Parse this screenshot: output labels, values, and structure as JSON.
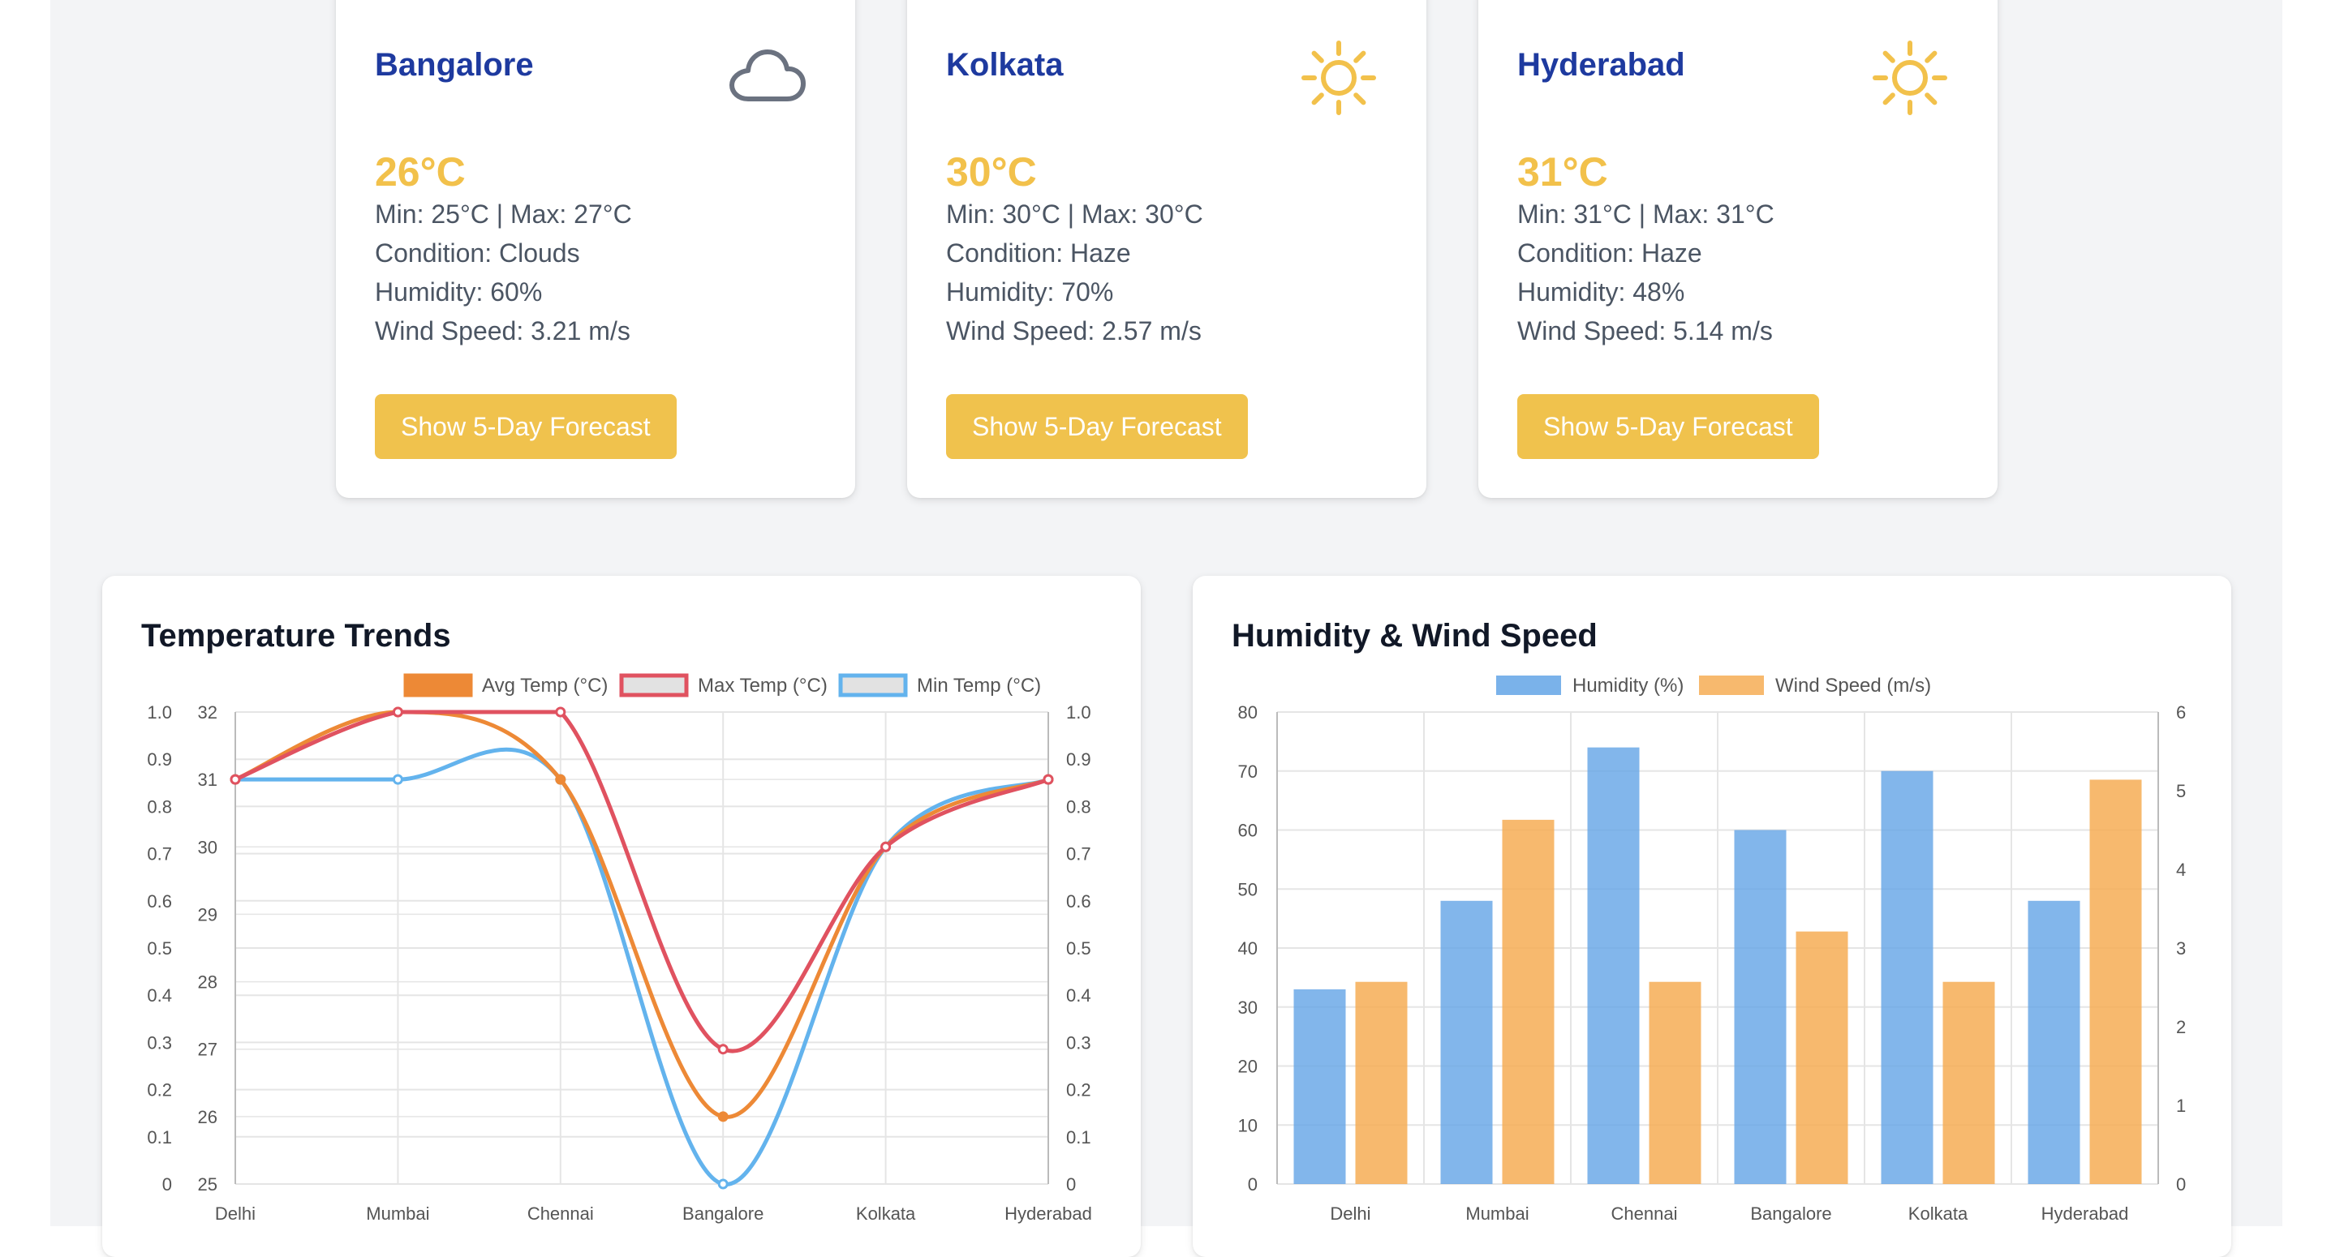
{
  "cities": [
    {
      "name": "Bangalore",
      "icon": "cloud-icon",
      "temp": "26°C",
      "minmax": "Min: 25°C | Max: 27°C",
      "condition": "Condition: Clouds",
      "humidity": "Humidity: 60%",
      "wind": "Wind Speed: 3.21 m/s",
      "button": "Show 5-Day Forecast"
    },
    {
      "name": "Kolkata",
      "icon": "sun-icon",
      "temp": "30°C",
      "minmax": "Min: 30°C | Max: 30°C",
      "condition": "Condition: Haze",
      "humidity": "Humidity: 70%",
      "wind": "Wind Speed: 2.57 m/s",
      "button": "Show 5-Day Forecast"
    },
    {
      "name": "Hyderabad",
      "icon": "sun-icon",
      "temp": "31°C",
      "minmax": "Min: 31°C | Max: 31°C",
      "condition": "Condition: Haze",
      "humidity": "Humidity: 48%",
      "wind": "Wind Speed: 5.14 m/s",
      "button": "Show 5-Day Forecast"
    }
  ],
  "colors": {
    "city_name": "#1e3a9f",
    "temp": "#f2c14b",
    "button": "#f0c24d",
    "avg_temp": "#ed8936",
    "max_temp": "#e05260",
    "min_temp": "#63b3ed",
    "humidity": "#63a4e6",
    "wind": "#f6ad55"
  },
  "chart_data": [
    {
      "type": "line",
      "title": "Temperature Trends",
      "categories": [
        "Delhi",
        "Mumbai",
        "Chennai",
        "Bangalore",
        "Kolkata",
        "Hyderabad"
      ],
      "series": [
        {
          "name": "Avg Temp (°C)",
          "values": [
            31,
            32,
            31,
            26,
            30,
            31
          ],
          "axis": "left",
          "legend_style": "filled"
        },
        {
          "name": "Max Temp (°C)",
          "values": [
            31,
            32,
            32,
            27,
            30,
            31
          ],
          "axis": "left",
          "legend_style": "outline"
        },
        {
          "name": "Min Temp (°C)",
          "values": [
            31,
            31,
            31,
            25,
            30,
            31
          ],
          "axis": "left",
          "legend_style": "outline"
        }
      ],
      "y_left": {
        "min": 25,
        "max": 32,
        "ticks": [
          "25",
          "26",
          "27",
          "28",
          "29",
          "30",
          "31",
          "32"
        ]
      },
      "y_outer": {
        "min": 0,
        "max": 1,
        "ticks": [
          "0",
          "0.1",
          "0.2",
          "0.3",
          "0.4",
          "0.5",
          "0.6",
          "0.7",
          "0.8",
          "0.9",
          "1.0"
        ]
      },
      "y_right": {
        "min": 0,
        "max": 1,
        "ticks": [
          "0",
          "0.1",
          "0.2",
          "0.3",
          "0.4",
          "0.5",
          "0.6",
          "0.7",
          "0.8",
          "0.9",
          "1.0"
        ]
      },
      "grid": true,
      "legend": "top"
    },
    {
      "type": "bar",
      "title": "Humidity & Wind Speed",
      "categories": [
        "Delhi",
        "Mumbai",
        "Chennai",
        "Bangalore",
        "Kolkata",
        "Hyderabad"
      ],
      "series": [
        {
          "name": "Humidity (%)",
          "values": [
            33,
            48,
            74,
            60,
            70,
            48
          ],
          "axis": "left"
        },
        {
          "name": "Wind Speed (m/s)",
          "values": [
            2.57,
            4.63,
            2.57,
            3.21,
            2.57,
            5.14
          ],
          "axis": "right"
        }
      ],
      "y_left": {
        "min": 0,
        "max": 80,
        "ticks": [
          "0",
          "10",
          "20",
          "30",
          "40",
          "50",
          "60",
          "70",
          "80"
        ]
      },
      "y_right": {
        "min": 0,
        "max": 6,
        "ticks": [
          "0",
          "1",
          "2",
          "3",
          "4",
          "5",
          "6"
        ]
      },
      "grid": true,
      "legend": "top"
    }
  ]
}
